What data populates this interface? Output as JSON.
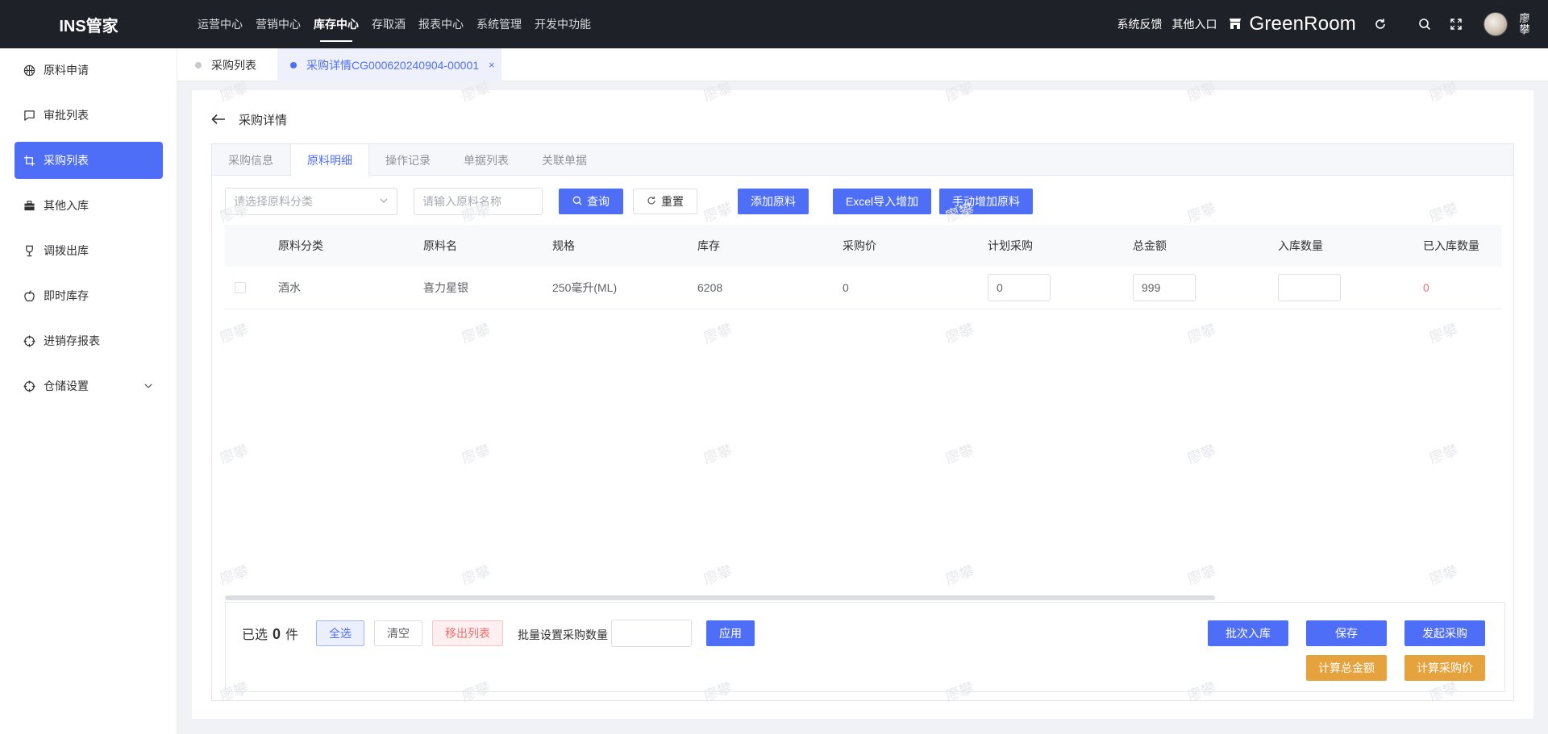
{
  "app": {
    "title": "INS管家"
  },
  "topnav": {
    "items": [
      {
        "label": "运营中心",
        "active": false
      },
      {
        "label": "营销中心",
        "active": false
      },
      {
        "label": "库存中心",
        "active": true
      },
      {
        "label": "存取酒",
        "active": false
      },
      {
        "label": "报表中心",
        "active": false
      },
      {
        "label": "系统管理",
        "active": false
      },
      {
        "label": "开发中功能",
        "active": false
      }
    ],
    "feedback": "系统反馈",
    "other_entry": "其他入口",
    "store_name": "GreenRoom",
    "user_name": "廖攀"
  },
  "sidebar": {
    "items": [
      {
        "label": "原料申请",
        "icon": "basketball-icon"
      },
      {
        "label": "审批列表",
        "icon": "chat-icon"
      },
      {
        "label": "采购列表",
        "icon": "crop-icon",
        "active": true
      },
      {
        "label": "其他入库",
        "icon": "briefcase-icon"
      },
      {
        "label": "调拨出库",
        "icon": "trophy-icon"
      },
      {
        "label": "即时库存",
        "icon": "apple-icon"
      },
      {
        "label": "进销存报表",
        "icon": "aim-icon"
      },
      {
        "label": "仓储设置",
        "icon": "aim-icon",
        "has_children": true
      }
    ]
  },
  "page_tabs": [
    {
      "label": "采购列表",
      "active": false
    },
    {
      "label": "采购详情CG000620240904-00001",
      "active": true,
      "close": "×"
    }
  ],
  "detail": {
    "title": "采购详情",
    "tabs": [
      {
        "label": "采购信息",
        "active": false
      },
      {
        "label": "原料明细",
        "active": true
      },
      {
        "label": "操作记录",
        "active": false
      },
      {
        "label": "单据列表",
        "active": false
      },
      {
        "label": "关联单据",
        "active": false
      }
    ],
    "filters": {
      "category_placeholder": "请选择原料分类",
      "name_placeholder": "请输入原料名称",
      "query": "查询",
      "reset": "重置",
      "add_material": "添加原料",
      "excel_import": "Excel导入增加",
      "manual_add": "手动增加原料"
    },
    "table": {
      "columns": [
        "原料分类",
        "原料名",
        "规格",
        "库存",
        "采购价",
        "计划采购",
        "总金额",
        "入库数量",
        "已入库数量"
      ],
      "rows": [
        {
          "category": "酒水",
          "name": "喜力星银",
          "spec": "250毫升(ML)",
          "stock": "6208",
          "price": "0",
          "planned": "0",
          "total": "999",
          "inbound_qty": "",
          "received": "0"
        }
      ]
    },
    "footer": {
      "selected_prefix": "已选",
      "selected_count": "0",
      "selected_suffix": "件",
      "select_all": "全选",
      "clear": "清空",
      "remove_list": "移出列表",
      "batch_label": "批量设置采购数量",
      "apply": "应用",
      "batch_inbound": "批次入库",
      "save": "保存",
      "initiate": "发起采购",
      "calc_total": "计算总金额",
      "calc_price": "计算采购价"
    }
  },
  "watermark": "廖攀",
  "colors": {
    "primary": "#4f6ef7",
    "warning": "#e6a23c",
    "danger": "#f56c6c",
    "header_bg": "#1f2129"
  }
}
